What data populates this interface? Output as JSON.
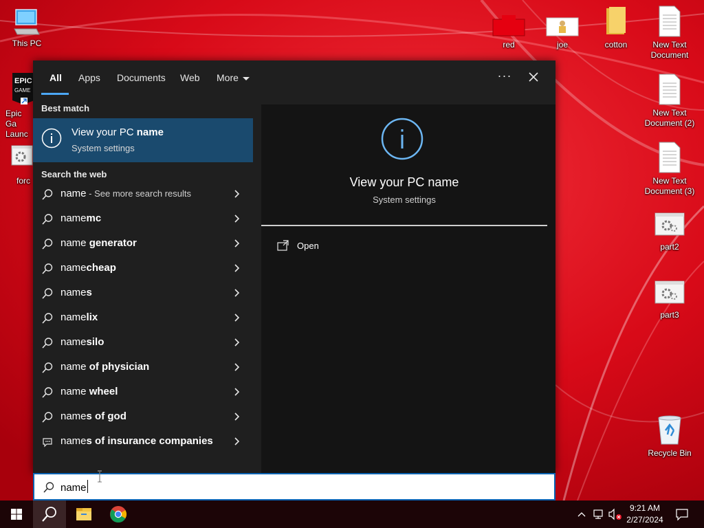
{
  "colors": {
    "wallpaper": "#c8000f",
    "panel_bg": "#1f1f1f",
    "preview_bg": "#141414",
    "selected_bg": "#1a4a6e",
    "accent": "#4ca7f5",
    "taskbar_bg": "#1c0507"
  },
  "desktop": {
    "icons": [
      {
        "label": "This PC",
        "icon": "computer-icon"
      },
      {
        "label": "Epic Ga Launc",
        "icon": "epic-games-icon"
      },
      {
        "label": "forc",
        "icon": "settings-file-icon"
      },
      {
        "label": "red",
        "icon": "image-file-icon"
      },
      {
        "label": "joe",
        "icon": "image-file-icon"
      },
      {
        "label": "cotton",
        "icon": "folder-icon"
      },
      {
        "label": "New Text Document",
        "icon": "text-file-icon"
      },
      {
        "label": "New Text Document (2)",
        "icon": "text-file-icon"
      },
      {
        "label": "New Text Document (3)",
        "icon": "text-file-icon"
      },
      {
        "label": "part2",
        "icon": "settings-file-icon"
      },
      {
        "label": "part3",
        "icon": "settings-file-icon"
      },
      {
        "label": "Recycle Bin",
        "icon": "recycle-bin-icon"
      }
    ]
  },
  "search": {
    "tabs": [
      "All",
      "Apps",
      "Documents",
      "Web",
      "More"
    ],
    "active_tab": "All",
    "more_icon": "chevron-down-icon",
    "ellipsis": "···",
    "best_match_heading": "Best match",
    "best_match": {
      "title_prefix": "View your PC ",
      "title_bold": "name",
      "subtitle": "System settings",
      "icon": "info-icon"
    },
    "web_heading": "Search the web",
    "web_results": [
      {
        "prefix": "name",
        "bold": "",
        "suffix": " - See more search results",
        "icon": "search-icon"
      },
      {
        "prefix": "name",
        "bold": "mc",
        "suffix": "",
        "icon": "search-icon"
      },
      {
        "prefix": "name",
        "bold": " generator",
        "suffix": "",
        "icon": "search-icon"
      },
      {
        "prefix": "name",
        "bold": "cheap",
        "suffix": "",
        "icon": "search-icon"
      },
      {
        "prefix": "name",
        "bold": "s",
        "suffix": "",
        "icon": "search-icon"
      },
      {
        "prefix": "name",
        "bold": "lix",
        "suffix": "",
        "icon": "search-icon"
      },
      {
        "prefix": "name",
        "bold": "silo",
        "suffix": "",
        "icon": "search-icon"
      },
      {
        "prefix": "name",
        "bold": " of physician",
        "suffix": "",
        "icon": "search-icon"
      },
      {
        "prefix": "name",
        "bold": " wheel",
        "suffix": "",
        "icon": "search-icon"
      },
      {
        "prefix": "name",
        "bold": "s of god",
        "suffix": "",
        "icon": "search-icon"
      },
      {
        "prefix": "name",
        "bold": "s of insurance companies",
        "suffix": "",
        "icon": "chat-icon"
      }
    ],
    "preview": {
      "title": "View your PC name",
      "subtitle": "System settings",
      "open_label": "Open",
      "open_icon": "open-window-icon"
    },
    "input": {
      "value": "name",
      "placeholder": ""
    }
  },
  "taskbar": {
    "buttons": [
      "windows-start-icon",
      "search-icon",
      "file-explorer-icon",
      "chrome-icon"
    ],
    "tray": [
      "chevron-up-icon",
      "network-icon",
      "volume-muted-icon",
      "notification-icon"
    ],
    "time": "9:21 AM",
    "date": "2/27/2024"
  }
}
